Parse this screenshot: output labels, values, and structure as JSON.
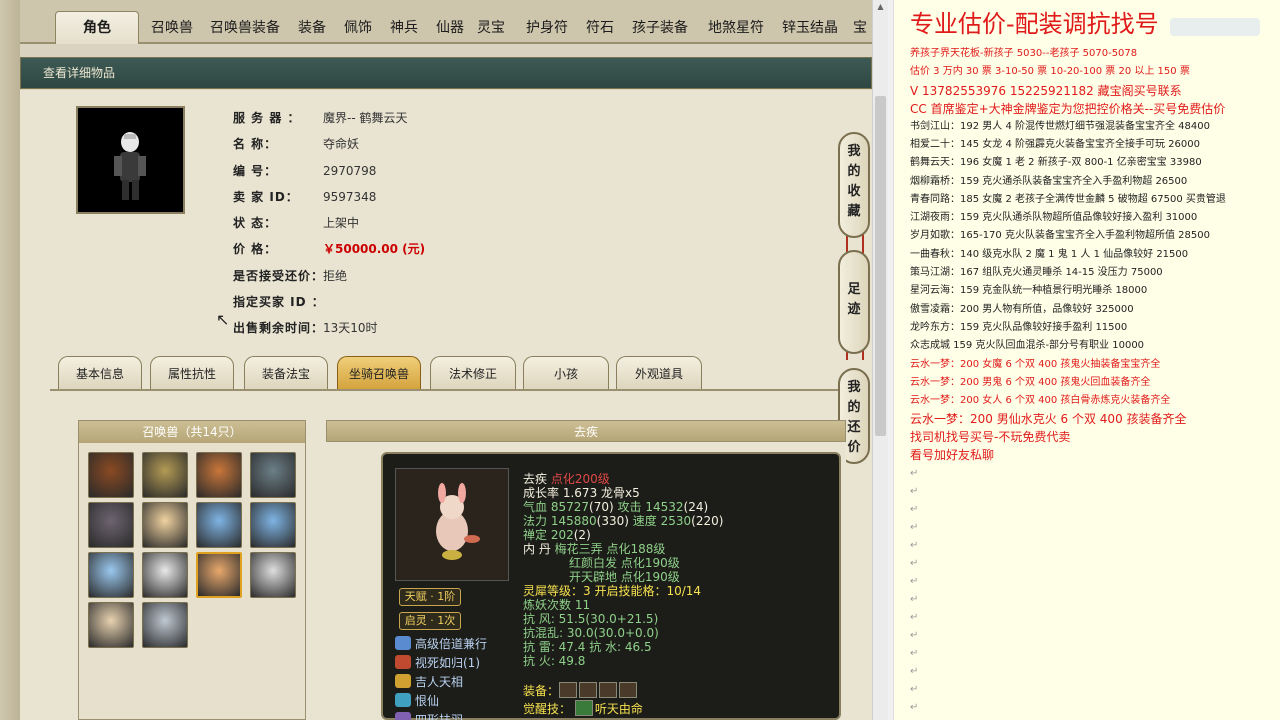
{
  "tabs": [
    "角色",
    "召唤兽",
    "召唤兽装备",
    "装备",
    "佩饰",
    "神兵",
    "仙器",
    "灵宝",
    "护身符",
    "符石",
    "孩子装备",
    "地煞星符",
    "锌玉结晶",
    "宝"
  ],
  "section_header": "查看详细物品",
  "item_info": [
    {
      "label": "服 务 器 ：",
      "value": "魔界-- 鹤舞云天"
    },
    {
      "label": "名       称：",
      "value": "夺命妖"
    },
    {
      "label": "编       号：",
      "value": "2970798"
    },
    {
      "label": "卖 家  ID：",
      "value": "9597348"
    },
    {
      "label": "状       态：",
      "value": "上架中"
    },
    {
      "label": "价       格：",
      "value": "￥50000.00 (元)"
    },
    {
      "label": "是否接受还价：",
      "value": "拒绝"
    },
    {
      "label": "指定买家 ID ：",
      "value": ""
    },
    {
      "label": "出售剩余时间：",
      "value": "13天10时"
    }
  ],
  "bottom_tabs": [
    "基本信息",
    "属性抗性",
    "装备法宝",
    "坐骑召唤兽",
    "法术修正",
    "小孩",
    "外观道具"
  ],
  "side_buttons": [
    "我的收藏",
    "足迹",
    "我的还价"
  ],
  "summon_header": "召唤兽（共14只）",
  "pet_colors": [
    "#8a4a22",
    "#b39b55",
    "#c9763a",
    "#6c7f88",
    "#6d6470",
    "#f0d2a0",
    "#7fb4e4",
    "#7fb4e4",
    "#9ac8ef",
    "#e8e8e8",
    "#e8a86c",
    "#dedede",
    "#e8d2b0",
    "#bfc8d2"
  ],
  "pet_name_header": "去疾",
  "pet_detail": {
    "name": "去疾",
    "level": "点化200级",
    "growth_label": "成长率",
    "growth": "1.673",
    "bone": "龙骨x5",
    "hp_label": "气血",
    "hp": "85727",
    "hp_add": "(70)",
    "atk_label": "攻击",
    "atk": "14532",
    "atk_add": "(24)",
    "mp_label": "法力",
    "mp": "145880",
    "mp_add": "(330)",
    "spd_label": "速度",
    "spd": "2530",
    "spd_add": "(220)",
    "zen_label": "禅定",
    "zen": "202",
    "zen_add": "(2)",
    "neidan_label": "内   丹",
    "neidan": [
      "梅花三弄 点化188级",
      "红颜白发 点化190级",
      "开天辟地 点化190级"
    ],
    "lingxi": "灵犀等级：3 开启技能格：10/14",
    "lianyao": "炼妖次数 11",
    "res": [
      "抗   风: 51.5(30.0+21.5)",
      "抗混乱: 30.0(30.0+0.0)",
      "抗   雷: 47.4 抗   水: 46.5",
      "抗   火: 49.8"
    ],
    "talent": "天赋 · 1阶",
    "qiling": "启灵 · 1次",
    "skills": [
      "高级倍道兼行",
      "视死如归(1)",
      "吉人天相",
      "恨仙",
      "四形扶羽"
    ],
    "equip_label": "装备：",
    "awaken_label": "觉醒技：",
    "awaken": "听天由命"
  },
  "doc": {
    "title": "专业估价-配装调抗找号",
    "lines": [
      {
        "t": "养孩子界天花板-新孩子 5030--老孩子 5070-5078",
        "c": "red"
      },
      {
        "t": "估价 3 万内 30 票   3-10-50 票   10-20-100 票   20 以上 150 票",
        "c": "red"
      },
      {
        "t": "V 13782553976     15225921182   藏宝阁买号联系",
        "c": "red big"
      },
      {
        "t": "CC 首席鉴定+大神金牌鉴定为您把控价格关--买号免费估价",
        "c": "red big"
      },
      {
        "t": "书剑江山：192 男人 4 阶混传世燃灯细节强混装备宝宝齐全 48400",
        "c": ""
      },
      {
        "t": "相爱二十：145 女龙 4 阶强霹克火装备宝宝齐全接手可玩 26000",
        "c": ""
      },
      {
        "t": "鹤舞云天：196 女魔 1 老 2 新孩子-双 800-1 亿亲密宝宝 33980",
        "c": ""
      },
      {
        "t": "烟柳霜桥：159 克火通杀队装备宝宝齐全入手盈利物超 26500",
        "c": ""
      },
      {
        "t": "青春同路：185 女魔 2 老孩子全满传世金麟 5 破物超 67500 买贵管退",
        "c": ""
      },
      {
        "t": "江湖夜雨：159 克火队通杀队物超所值品像较好接入盈利 31000",
        "c": ""
      },
      {
        "t": "岁月如歌：165-170 克火队装备宝宝齐全入手盈利物超所值 28500",
        "c": ""
      },
      {
        "t": "一曲春秋：140 级克水队 2 魔 1 鬼 1 人 1 仙品像较好 21500",
        "c": ""
      },
      {
        "t": "策马江湖：167 组队克火通灵睡杀 14-15 没压力 75000",
        "c": ""
      },
      {
        "t": "星河云海：159 克金队统一种植景行明光睡杀 18000",
        "c": ""
      },
      {
        "t": "傲雪凌霜：200 男人物有所值，品像较好 325000",
        "c": ""
      },
      {
        "t": "龙吟东方：159 克火队品像较好接手盈利 11500",
        "c": ""
      },
      {
        "t": "众志成城 159 克火队回血混杀-部分号有职业 10000",
        "c": ""
      },
      {
        "t": "云水一梦：200 女魔 6 个双 400 孩鬼火抽装备宝宝齐全",
        "c": "red"
      },
      {
        "t": "云水一梦：200 男鬼 6 个双 400 孩鬼火回血装备齐全",
        "c": "red"
      },
      {
        "t": "云水一梦：200 女人 6 个双 400 孩白骨赤炼克火装备齐全",
        "c": "red"
      },
      {
        "t": "云水一梦：200 男仙水克火 6 个双 400 孩装备齐全",
        "c": "red big"
      },
      {
        "t": "找司机找号买号-不玩免费代卖",
        "c": "red big"
      },
      {
        "t": "看号加好友私聊",
        "c": "red big"
      }
    ],
    "para_mark": "↵"
  }
}
